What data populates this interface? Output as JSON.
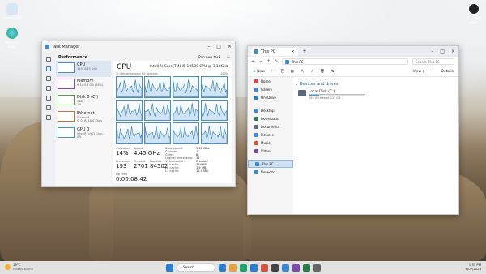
{
  "desktop": {
    "icons": [
      {
        "label": "Recycle Bin",
        "color": "#d8e6f4"
      },
      {
        "label": "Microsoft Edge",
        "color": "#1da46a"
      }
    ],
    "top_right_icon_label": "Microsoft user"
  },
  "task_manager": {
    "title": "Task Manager",
    "section": "Performance",
    "run_new_task": "Run new task",
    "items": [
      {
        "label": "CPU",
        "sub": "14%  4.45 GHz"
      },
      {
        "label": "Memory",
        "sub": "9.1/15.7 GB (58%)"
      },
      {
        "label": "Disk 0 (C:)",
        "sub": "SSD\n1%"
      },
      {
        "label": "Ethernet",
        "sub": "Ethernet\nS: 0  R: 16.0 Kbps"
      },
      {
        "label": "GPU 0",
        "sub": "Intel(R) UHD Grap...\n0%"
      }
    ],
    "cpu": {
      "title": "CPU",
      "model": "Intel(R) Core(TM) i5-10500 CPU @ 3.10GHz",
      "util_caption": "% Utilization over 60 seconds",
      "util_max": "100%",
      "utilization_label": "Utilization",
      "utilization": "14%",
      "speed_label": "Speed",
      "speed": "4.45 GHz",
      "processes_label": "Processes",
      "processes": "193",
      "threads_label": "Threads",
      "threads": "2701",
      "handles_label": "Handles",
      "handles": "84502",
      "uptime_label": "Up time",
      "uptime": "0:00:08:42",
      "specs": [
        {
          "k": "Base speed:",
          "v": "3.10 GHz"
        },
        {
          "k": "Sockets:",
          "v": "1"
        },
        {
          "k": "Cores:",
          "v": "6"
        },
        {
          "k": "Logical processors:",
          "v": "12"
        },
        {
          "k": "Virtualization:",
          "v": "Enabled"
        },
        {
          "k": "L1 cache:",
          "v": "384 KB"
        },
        {
          "k": "L2 cache:",
          "v": "1.5 MB"
        },
        {
          "k": "L3 cache:",
          "v": "12.0 MB"
        }
      ]
    }
  },
  "file_explorer": {
    "title": "This PC",
    "address": "This PC",
    "search_placeholder": "Search This PC",
    "new_label": "New",
    "view_label": "View",
    "details_label": "Details",
    "section_header": "Devices and drives",
    "drive_name": "Local Disk (C:)",
    "drive_usage": "195 GB free of 237 GB",
    "drive_used_fraction": 0.18,
    "nav": [
      {
        "label": "Home",
        "color": "#d44"
      },
      {
        "label": "Gallery",
        "color": "#3a8ad6"
      },
      {
        "label": "OneDrive",
        "color": "#2b7cd3"
      },
      {
        "label": "Desktop",
        "color": "#3a8ad6"
      },
      {
        "label": "Downloads",
        "color": "#2a7a4a"
      },
      {
        "label": "Documents",
        "color": "#5a6a7a"
      },
      {
        "label": "Pictures",
        "color": "#3a8ad6"
      },
      {
        "label": "Music",
        "color": "#d9533a"
      },
      {
        "label": "Videos",
        "color": "#7a4ab0"
      },
      {
        "label": "This PC",
        "color": "#3a8ad6"
      },
      {
        "label": "Network",
        "color": "#3a8ad6"
      }
    ]
  },
  "taskbar": {
    "weather_temp": "19°C",
    "weather_desc": "Mostly sunny",
    "search_placeholder": "Search",
    "time": "1:31 PM",
    "date": "6/07/2024",
    "apps": [
      "#2b7cd3",
      "#e8a33a",
      "#1da46a",
      "#2b7cd3",
      "#d9533a",
      "#444",
      "#3a8ad6",
      "#7a4ab0",
      "#2a7a4a",
      "#666"
    ]
  }
}
